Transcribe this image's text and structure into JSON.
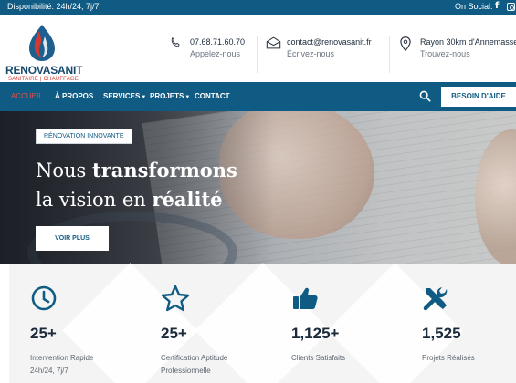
{
  "topbar": {
    "availability": "Disponibilité: 24h/24, 7j/7",
    "social_label": "On Social:",
    "social_icons": [
      "facebook-icon",
      "instagram-icon"
    ]
  },
  "header": {
    "logo": {
      "brand": "RENOVASANIT",
      "tagline": "SANITAIRE | CHAUFFAGE"
    },
    "contacts": [
      {
        "icon": "phone-icon",
        "value": "07.68.71.60.70",
        "caption": "Appelez-nous"
      },
      {
        "icon": "email-icon",
        "value": "contact@renovasanit.fr",
        "caption": "Écrivez-nous"
      },
      {
        "icon": "location-pin-icon",
        "value": "Rayon 30km d'Annemasse",
        "caption": "Trouvez-nous"
      }
    ]
  },
  "nav": {
    "items": [
      {
        "label": "ACCUEIL",
        "active": true
      },
      {
        "label": "À PROPOS"
      },
      {
        "label": "SERVICES",
        "dropdown": true
      },
      {
        "label": "PROJETS",
        "dropdown": true
      },
      {
        "label": "CONTACT"
      }
    ],
    "help_button": "BESOIN D'AIDE"
  },
  "hero": {
    "badge": "RÉNOVATION INNOVANTE",
    "line1_normal": "Nous ",
    "line1_bold": "transformons",
    "line2_normal": "la vision en ",
    "line2_bold": "réalité",
    "cta": "VOIR PLUS"
  },
  "stats": [
    {
      "icon": "clock-icon",
      "value": "25+",
      "label_1": "Intervention Rapide",
      "label_2": "24h/24, 7j/7"
    },
    {
      "icon": "star-icon",
      "value": "25+",
      "label_1": "Certification Aptitude",
      "label_2": "Professionnelle"
    },
    {
      "icon": "thumbs-up-icon",
      "value": "1,125+",
      "label_1": "Clients Satisfaits",
      "label_2": ""
    },
    {
      "icon": "tools-icon",
      "value": "1,525",
      "label_1": "Projets Réalisés",
      "label_2": ""
    }
  ],
  "colors": {
    "primary": "#0f5b83",
    "accent": "#e0524c",
    "brand_red": "#d23a2f"
  }
}
